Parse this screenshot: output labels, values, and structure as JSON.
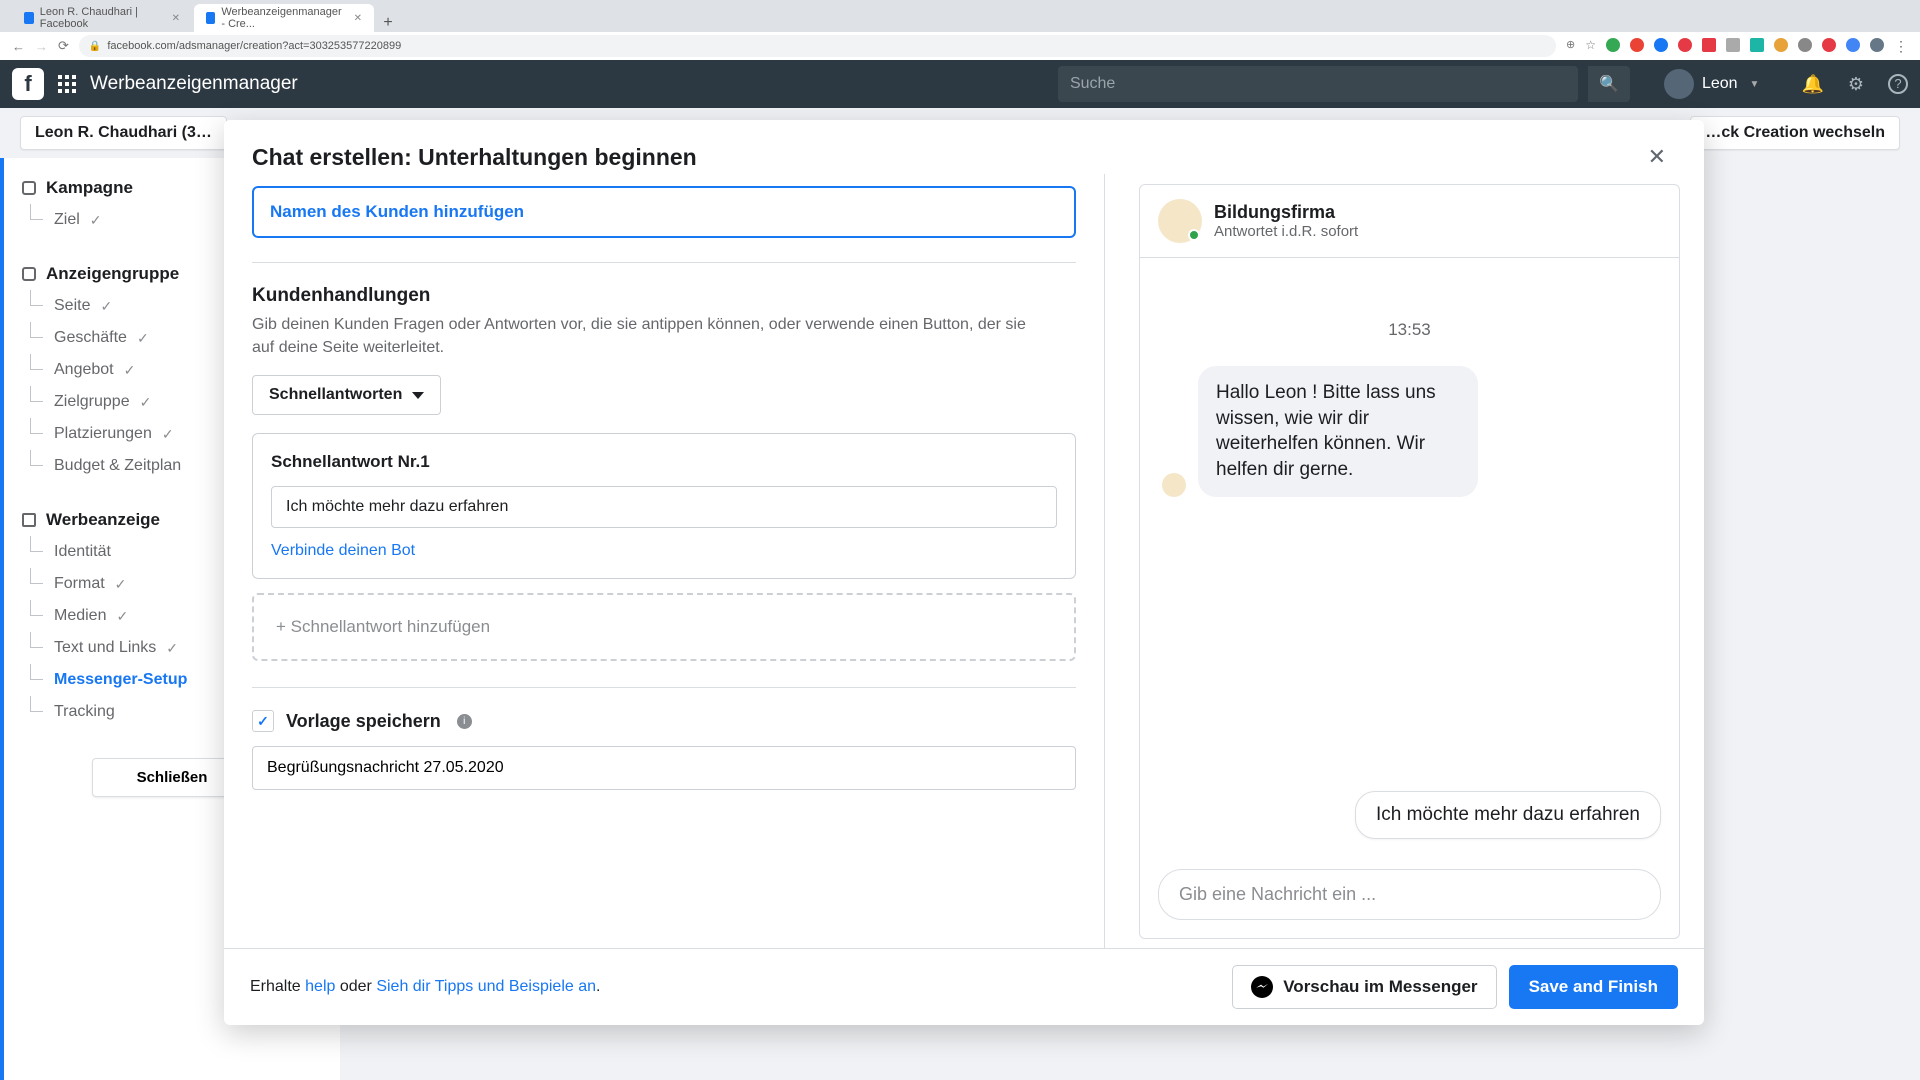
{
  "browser": {
    "tabs": [
      {
        "title": "Leon R. Chaudhari | Facebook"
      },
      {
        "title": "Werbeanzeigenmanager - Cre..."
      }
    ],
    "url": "facebook.com/adsmanager/creation?act=303253577220899"
  },
  "fb_header": {
    "app_title": "Werbeanzeigenmanager",
    "search_placeholder": "Suche",
    "user_name": "Leon"
  },
  "pill_row": {
    "account_label": "Leon R. Chaudhari (3…",
    "right_label": "…ck Creation wechseln"
  },
  "left_nav": {
    "campaign": {
      "label": "Kampagne",
      "items": [
        {
          "label": "Ziel",
          "done": true
        }
      ]
    },
    "adset": {
      "label": "Anzeigengruppe",
      "items": [
        {
          "label": "Seite",
          "done": true
        },
        {
          "label": "Geschäfte",
          "done": true
        },
        {
          "label": "Angebot",
          "done": true
        },
        {
          "label": "Zielgruppe",
          "done": true
        },
        {
          "label": "Platzierungen",
          "done": true
        },
        {
          "label": "Budget & Zeitplan",
          "done": false
        }
      ]
    },
    "ad": {
      "label": "Werbeanzeige",
      "items": [
        {
          "label": "Identität",
          "done": false
        },
        {
          "label": "Format",
          "done": true
        },
        {
          "label": "Medien",
          "done": true
        },
        {
          "label": "Text und Links",
          "done": true
        },
        {
          "label": "Messenger-Setup",
          "done": false,
          "active": true
        },
        {
          "label": "Tracking",
          "done": false
        }
      ]
    },
    "close_label": "Schließen"
  },
  "modal": {
    "title": "Chat erstellen: Unterhaltungen beginnen",
    "name_input_label": "Namen des Kunden hinzufügen",
    "actions_section": {
      "heading": "Kundenhandlungen",
      "description": "Gib deinen Kunden Fragen oder Antworten vor, die sie antippen können, oder verwende einen Button, der sie auf deine Seite weiterleitet.",
      "dropdown_label": "Schnellantworten"
    },
    "quick_reply": {
      "title": "Schnellantwort Nr.1",
      "value": "Ich möchte mehr dazu erfahren",
      "bot_link": "Verbinde deinen Bot"
    },
    "add_quick_label": "Schnellantwort hinzufügen",
    "save_template": {
      "checkbox_checked": true,
      "label": "Vorlage speichern",
      "value": "Begrüßungsnachricht 27.05.2020"
    },
    "footer": {
      "help_prefix": "Erhalte ",
      "help_link": "help",
      "help_middle": " oder ",
      "tips_link": "Sieh dir Tipps und Beispiele an",
      "help_suffix": ".",
      "preview_btn": "Vorschau im Messenger",
      "save_btn": "Save and Finish"
    }
  },
  "preview": {
    "brand_name": "Bildungsfirma",
    "brand_subtitle": "Antwortet i.d.R. sofort",
    "time": "13:53",
    "message": "Hallo Leon ! Bitte lass uns wissen, wie wir dir weiterhelfen können. Wir helfen dir gerne.",
    "reply_chip": "Ich möchte mehr dazu erfahren",
    "input_placeholder": "Gib eine Nachricht ein ..."
  }
}
